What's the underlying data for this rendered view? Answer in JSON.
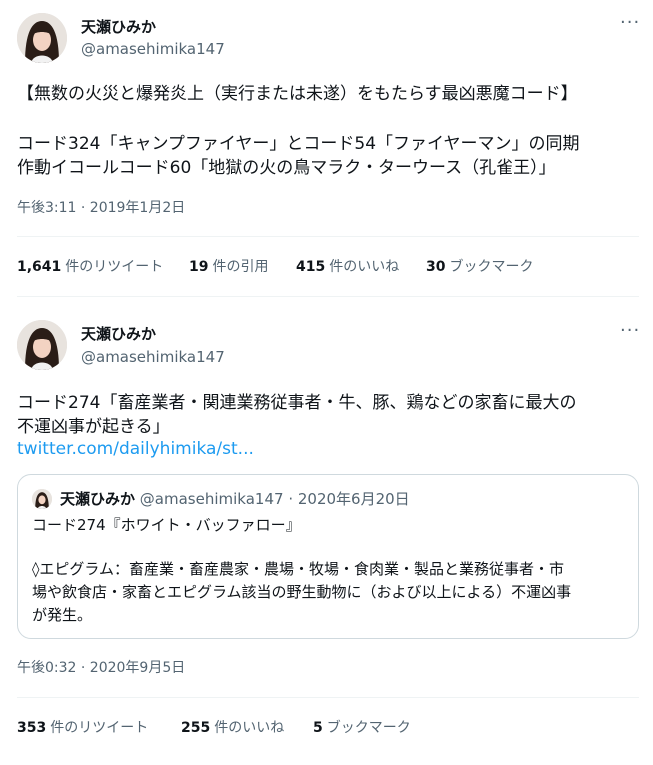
{
  "tweets": [
    {
      "author_name": "天瀬ひみか",
      "author_handle": "@amasehimika147",
      "more_icon": "more-horizontal-icon",
      "text_lines": [
        "【無数の火災と爆発炎上（実行または未遂）をもたらす最凶悪魔コード】",
        "",
        "コード324「キャンプファイヤー」とコード54「ファイヤーマン」の同期",
        "作動イコールコード60「地獄の火の鳥マラク・ターウース（孔雀王）」"
      ],
      "timestamp": "午後3:11 · 2019年1月2日",
      "stats": [
        {
          "count": "1,641",
          "label": "件のリツイート"
        },
        {
          "count": "19",
          "label": "件の引用"
        },
        {
          "count": "415",
          "label": "件のいいね"
        },
        {
          "count": "30",
          "label": "ブックマーク"
        }
      ]
    },
    {
      "author_name": "天瀬ひみか",
      "author_handle": "@amasehimika147",
      "more_icon": "more-horizontal-icon",
      "text_lines": [
        "コード274「畜産業者・関連業務従事者・牛、豚、鶏などの家畜に最大の",
        "不運凶事が起きる」"
      ],
      "link": "twitter.com/dailyhimika/st...",
      "quote": {
        "author_name": "天瀬ひみか",
        "author_handle": "@amasehimika147",
        "date": "· 2020年6月20日",
        "lines": [
          "コード274『ホワイト・バッファロー』",
          "",
          "◊エピグラム：畜産業・畜産農家・農場・牧場・食肉業・製品と業務従事者・市",
          "場や飲食店・家畜とエピグラム該当の野生動物に（および以上による）不運凶事",
          "が発生。"
        ]
      },
      "timestamp": "午後0:32 · 2020年9月5日",
      "stats": [
        {
          "count": "353",
          "label": "件のリツイート"
        },
        {
          "count": "255",
          "label": "件のいいね"
        },
        {
          "count": "5",
          "label": "ブックマーク"
        }
      ]
    }
  ]
}
